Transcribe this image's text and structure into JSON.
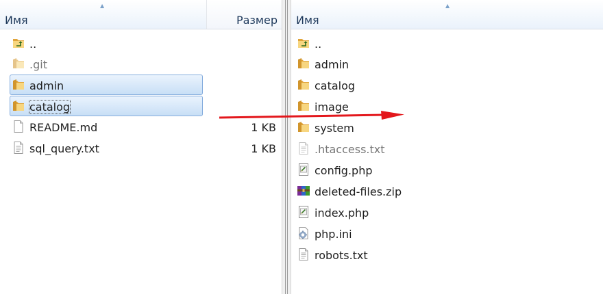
{
  "left_panel": {
    "columns": {
      "name": "Имя",
      "size": "Размер"
    },
    "items": [
      {
        "name": "..",
        "size": "",
        "icon": "up-folder-icon"
      },
      {
        "name": ".git",
        "size": "",
        "icon": "folder-icon"
      },
      {
        "name": "admin",
        "size": "",
        "icon": "folder-icon"
      },
      {
        "name": "catalog",
        "size": "",
        "icon": "folder-icon"
      },
      {
        "name": "README.md",
        "size": "1 KB",
        "icon": "file-icon"
      },
      {
        "name": "sql_query.txt",
        "size": "1 KB",
        "icon": "text-file-icon"
      }
    ]
  },
  "right_panel": {
    "columns": {
      "name": "Имя"
    },
    "items": [
      {
        "name": "..",
        "icon": "up-folder-icon"
      },
      {
        "name": "admin",
        "icon": "folder-icon"
      },
      {
        "name": "catalog",
        "icon": "folder-icon"
      },
      {
        "name": "image",
        "icon": "folder-icon"
      },
      {
        "name": "system",
        "icon": "folder-icon"
      },
      {
        "name": ".htaccess.txt",
        "icon": "text-file-icon"
      },
      {
        "name": "config.php",
        "icon": "php-file-icon"
      },
      {
        "name": "deleted-files.zip",
        "icon": "archive-icon"
      },
      {
        "name": "index.php",
        "icon": "php-file-icon"
      },
      {
        "name": "php.ini",
        "icon": "settings-file-icon"
      },
      {
        "name": "robots.txt",
        "icon": "text-file-icon"
      }
    ]
  },
  "colors": {
    "selection": "#c8dff6",
    "selection_border": "#84acdd",
    "arrow": "#e3171c",
    "header_text": "#1e395b"
  }
}
